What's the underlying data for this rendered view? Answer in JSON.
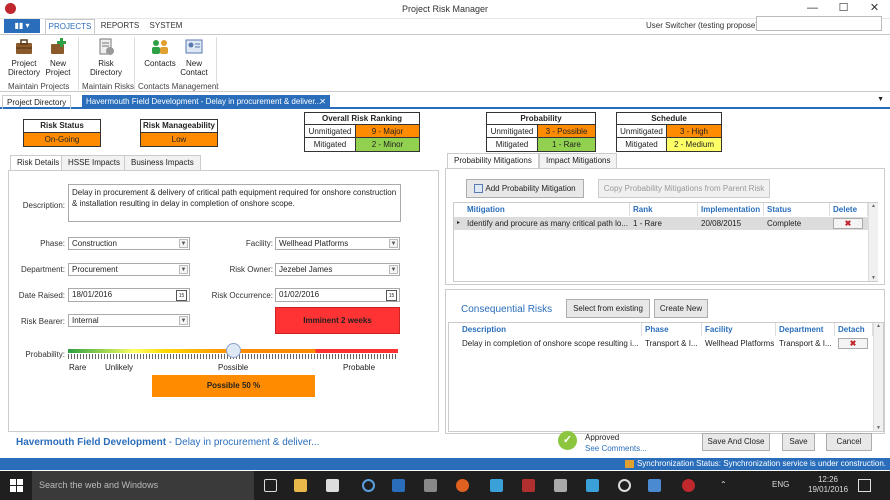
{
  "window": {
    "title": "Project Risk Manager",
    "minimize": "—",
    "maximize": "☐",
    "close": "✕"
  },
  "ribbon_tabs": {
    "file": "▮▮ ▾",
    "projects": "PROJECTS",
    "reports": "REPORTS",
    "system": "SYSTEM"
  },
  "user_switcher": {
    "label": "User Switcher (testing propose)",
    "value": ""
  },
  "ribbon": {
    "project_directory": "Project Directory",
    "new_project": "New Project",
    "group_projects": "Maintain Projects",
    "risk_directory": "Risk Directory",
    "group_risks": "Maintain Risks",
    "contacts": "Contacts",
    "new_contact": "New Contact",
    "group_contacts": "Contacts Management"
  },
  "doc_tabs": {
    "tab1": "Project Directory",
    "tab2": "Havermouth Field Development - Delay in procurement & deliver...",
    "close": "✕",
    "overflow": "▼"
  },
  "risk_status": {
    "header": "Risk Status",
    "value": "On-Going"
  },
  "risk_manageability": {
    "header": "Risk Manageability",
    "value": "Low"
  },
  "overall_ranking": {
    "header": "Overall Risk Ranking",
    "unmitigated_label": "Unmitigated",
    "unmitigated_value": "9 - Major",
    "mitigated_label": "Mitigated",
    "mitigated_value": "2 - Minor"
  },
  "probability": {
    "header": "Probability",
    "unmitigated_label": "Unmitigated",
    "unmitigated_value": "3 - Possible",
    "mitigated_label": "Mitigated",
    "mitigated_value": "1 - Rare"
  },
  "schedule": {
    "header": "Schedule",
    "unmitigated_label": "Unmitigated",
    "unmitigated_value": "3 - High",
    "mitigated_label": "Mitigated",
    "mitigated_value": "2 - Medium"
  },
  "colors": {
    "orange": "#ff8c00",
    "green": "#92d050",
    "red": "#ff3333",
    "yellow": "#ffff66",
    "accent": "#2a6ebb"
  },
  "left_tabs": {
    "details": "Risk Details",
    "hsse": "HSSE Impacts",
    "business": "Business Impacts"
  },
  "form": {
    "description_label": "Description:",
    "description": "Delay in procurement & delivery of critical path equipment required for onshore construction & installation resulting in delay in completion of onshore scope.",
    "phase_label": "Phase:",
    "phase": "Construction",
    "facility_label": "Facility:",
    "facility": "Wellhead Platforms",
    "department_label": "Department:",
    "department": "Procurement",
    "owner_label": "Risk Owner:",
    "owner": "Jezebel James",
    "date_raised_label": "Date Raised:",
    "date_raised": "18/01/2016",
    "occurrence_label": "Risk Occurrence:",
    "occurrence": "01/02/2016",
    "imminent": "Imminent 2 weeks",
    "bearer_label": "Risk Bearer:",
    "bearer": "Internal",
    "probability_label": "Probability:",
    "scale_rare": "Rare",
    "scale_unlikely": "Unlikely",
    "scale_possible": "Possible",
    "scale_probable": "Probable",
    "slider_level": 0.5,
    "possible_pct": "Possible 50 %"
  },
  "right_tabs": {
    "prob_mitigations": "Probability Mitigations",
    "impact_mitigations": "Impact Mitigations"
  },
  "mitigations": {
    "add_button": "Add Probability Mitigation",
    "copy_button": "Copy Probability Mitigations from Parent Risk",
    "headers": [
      "Mitigation",
      "Rank",
      "Implementation",
      "Status",
      "Delete"
    ],
    "rows": [
      {
        "mitigation": "Identify and procure as many critical path lo...",
        "rank": "1 - Rare",
        "implementation": "20/08/2015",
        "status": "Complete"
      }
    ]
  },
  "consequential": {
    "title": "Consequential Risks",
    "select_button": "Select from existing",
    "create_button": "Create New",
    "headers": [
      "Description",
      "Phase",
      "Facility",
      "Department",
      "Detach"
    ],
    "rows": [
      {
        "description": "Delay in completion of onshore scope resulting i...",
        "phase": "Transport & I...",
        "facility": "Wellhead Platforms",
        "department": "Transport & I..."
      }
    ]
  },
  "footer": {
    "project": "Havermouth Field Development",
    "risk": " - Delay in procurement & deliver...",
    "approved": "Approved",
    "see_comments": "See Comments...",
    "save_close": "Save And Close",
    "save": "Save",
    "cancel": "Cancel"
  },
  "status_bar": {
    "label": "Synchronization Status:",
    "message": "Synchronization service is under construction."
  },
  "taskbar": {
    "search": "Search the web and Windows",
    "lang": "ENG",
    "time": "12:26",
    "date": "19/01/2016"
  }
}
